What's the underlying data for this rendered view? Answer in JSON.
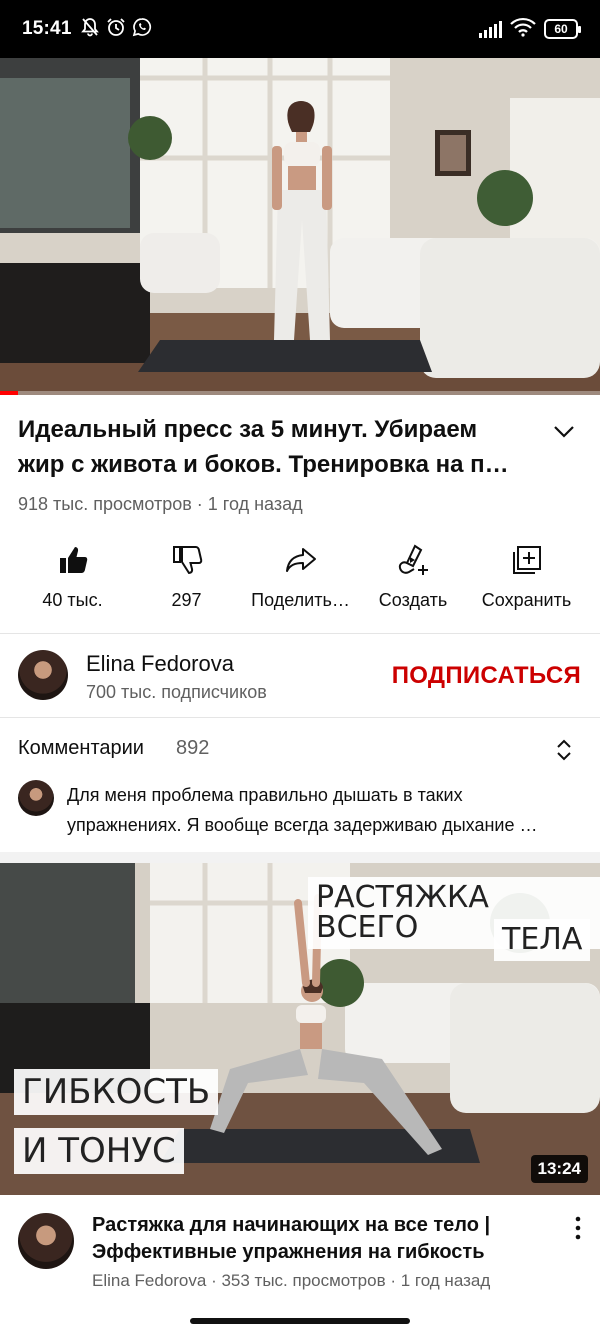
{
  "status_bar": {
    "time": "15:41",
    "left_icons": [
      "muted-bell-icon",
      "alarm-icon",
      "whatsapp-icon"
    ],
    "battery": "60"
  },
  "player": {
    "progress_fraction": 0.03,
    "progress_color": "#ff0000"
  },
  "video": {
    "title": "Идеальный пресс за 5 минут. Убираем жир с живота и боков. Тренировка на п…",
    "meta": "918 тыс. просмотров · 1 год назад"
  },
  "actions": {
    "like": "40 тыс.",
    "dislike": "297",
    "share": "Поделить…",
    "create": "Создать",
    "save": "Сохранить"
  },
  "channel": {
    "name": "Elina Fedorova",
    "subscribers": "700 тыс. подписчиков",
    "subscribe_label": "ПОДПИСАТЬСЯ",
    "subscribe_color": "#cc0000"
  },
  "comments": {
    "title": "Комментарии",
    "count": "892",
    "top_comment": "Для меня проблема правильно дышать в таких упражнениях. Я вообще всегда задерживаю дыхание …"
  },
  "next_video": {
    "thumb_text_top_1": "РАСТЯЖКА ВСЕГО",
    "thumb_text_top_2": "ТЕЛА",
    "thumb_text_bottom_1": "ГИБКОСТЬ",
    "thumb_text_bottom_2": "И ТОНУС",
    "duration": "13:24",
    "title": "Растяжка для начинающих на все тело | Эффективные упражнения на гибкость",
    "meta": "Elina Fedorova · 353 тыс. просмотров · 1 год назад"
  }
}
